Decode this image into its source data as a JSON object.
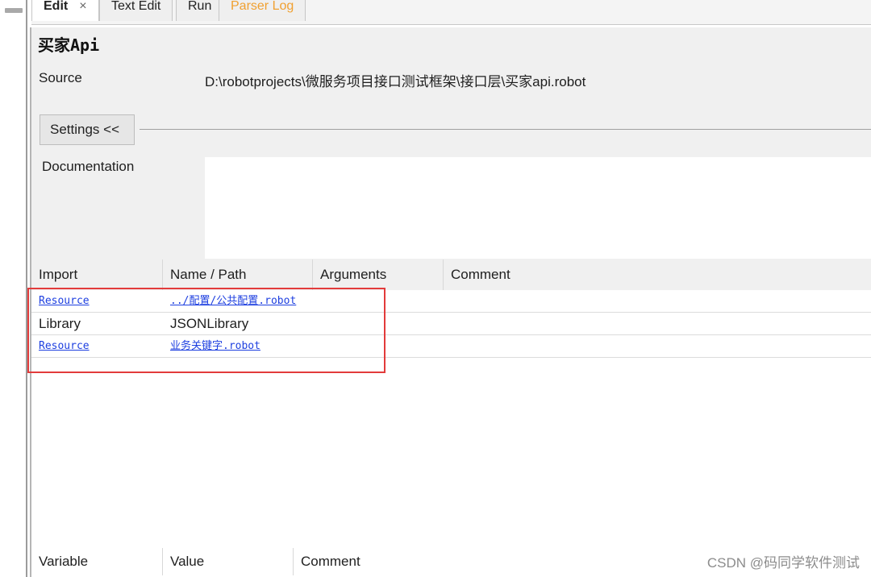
{
  "tabs": [
    {
      "label": "Edit",
      "close": "×",
      "active": true
    },
    {
      "label": "Text Edit"
    },
    {
      "label": "Run"
    },
    {
      "label": "Parser Log"
    }
  ],
  "title": "买家Api",
  "source": {
    "label": "Source",
    "value": "D:\\robotprojects\\微服务项目接口测试框架\\接口层\\买家api.robot"
  },
  "settings_button": "Settings <<",
  "documentation_label": "Documentation",
  "imports": {
    "headers": [
      "Import",
      "Name / Path",
      "Arguments",
      "Comment"
    ],
    "rows": [
      {
        "type": "Resource",
        "name": "../配置/公共配置.robot",
        "type_link": true,
        "name_link": true
      },
      {
        "type": "Library",
        "name": "JSONLibrary",
        "type_link": false,
        "name_link": false
      },
      {
        "type": "Resource",
        "name": "业务关键字.robot",
        "type_link": true,
        "name_link": true
      }
    ]
  },
  "variables": {
    "headers": [
      "Variable",
      "Value",
      "Comment"
    ]
  },
  "watermark": "CSDN @码同学软件测试",
  "colors": {
    "highlight": "#e23b3b",
    "link": "#1d3fe0",
    "parser_tab": "#f0a030"
  }
}
